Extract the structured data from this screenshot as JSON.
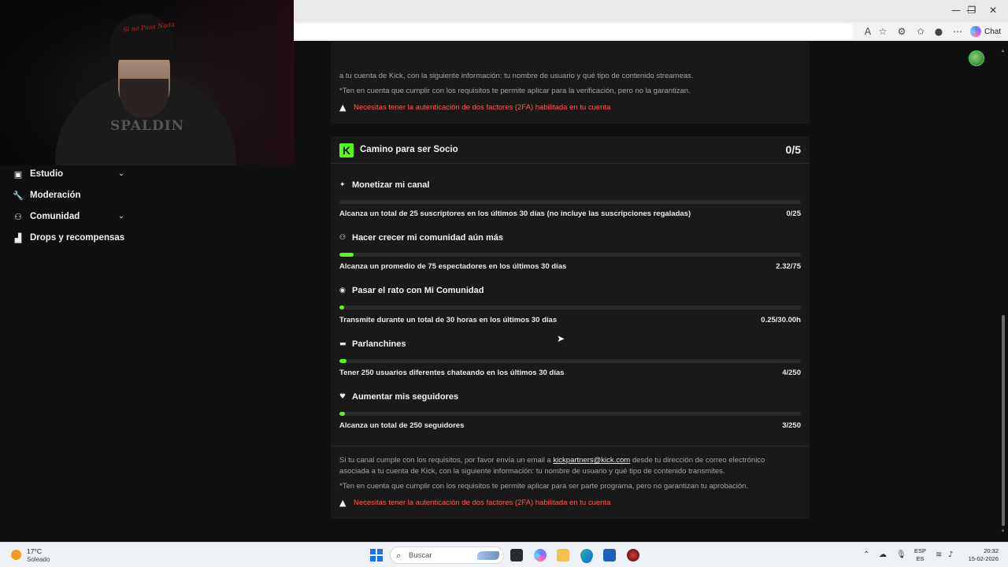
{
  "browser": {
    "minimize": "—",
    "restore": "❐",
    "close": "✕",
    "chat_label": "Chat"
  },
  "sidebar": {
    "items": [
      {
        "label": "Estudio",
        "icon": "studio-icon",
        "expandable": true
      },
      {
        "label": "Moderación",
        "icon": "wrench-icon",
        "expandable": false
      },
      {
        "label": "Comunidad",
        "icon": "community-icon",
        "expandable": true
      },
      {
        "label": "Drops y recompensas",
        "icon": "drops-icon",
        "expandable": false
      }
    ]
  },
  "verification_card": {
    "text_line": "a tu cuenta de Kick, con la siguiente información: tu nombre de usuario y qué tipo de contenido streameas.",
    "note": "*Ten en cuenta que cumplir con los requisitos te permite aplicar para la verificación, pero no la garantizan.",
    "warning": "Necesitas tener la autenticación de dos factores (2FA) habilitada en tu cuenta"
  },
  "partner_card": {
    "title": "Camino para ser Socio",
    "count": "0/5",
    "logo": "K",
    "goals": [
      {
        "icon": "sparkle-icon",
        "title": "Monetizar mi canal",
        "description": "Alcanza un total de 25 suscriptores en los últimos 30 días (no incluye las suscripciones regaladas)",
        "value": "0/25",
        "progress": 0.0
      },
      {
        "icon": "users-icon",
        "title": "Hacer crecer mi comunidad aún más",
        "description": "Alcanza un promedio de 75 espectadores en los últimos 30 días",
        "value": "2.32/75",
        "progress": 0.031
      },
      {
        "icon": "broadcast-icon",
        "title": "Pasar el rato con Mi Comunidad",
        "description": "Transmite durante un total de 30 horas en los últimos 30 días",
        "value": "0.25/30.00h",
        "progress": 0.008
      },
      {
        "icon": "chat-bubble-icon",
        "title": "Parlanchines",
        "description": "Tener 250 usuarios diferentes chateando en los últimos 30 días",
        "value": "4/250",
        "progress": 0.016
      },
      {
        "icon": "heart-icon",
        "title": "Aumentar mis seguidores",
        "description": "Alcanza un total de 250 seguidores",
        "value": "3/250",
        "progress": 0.012
      }
    ],
    "footer": {
      "line1_prefix": "Si tu canal cumple con los requisitos, por favor envía un email a",
      "email": "kickpartners@kick.com",
      "line1_suffix": "desde tu dirección de correo electrónico",
      "line2": "asociada a tu cuenta de Kick, con la siguiente información: tu nombre de usuario y qué tipo de contenido transmites.",
      "note": "*Ten en cuenta que cumplir con los requisitos te permite aplicar para ser parte programa, pero no garantizan tu aprobación.",
      "warning": "Necesitas tener la autenticación de dos factores (2FA) habilitada en tu cuenta"
    }
  },
  "webcam": {
    "cap_text": "Si no Pasa Nada",
    "shirt_text": "SPALDIN"
  },
  "taskbar": {
    "temperature": "17°C",
    "weather": "Soleado",
    "search_placeholder": "Buscar",
    "lang_top": "ESP",
    "lang_bottom": "ES",
    "time": "20:32",
    "date": "15-02-2026"
  },
  "colors": {
    "accent": "#53fc18",
    "warning": "#ff5a5a",
    "card_bg": "#19191a",
    "page_bg": "#0f0f10"
  }
}
